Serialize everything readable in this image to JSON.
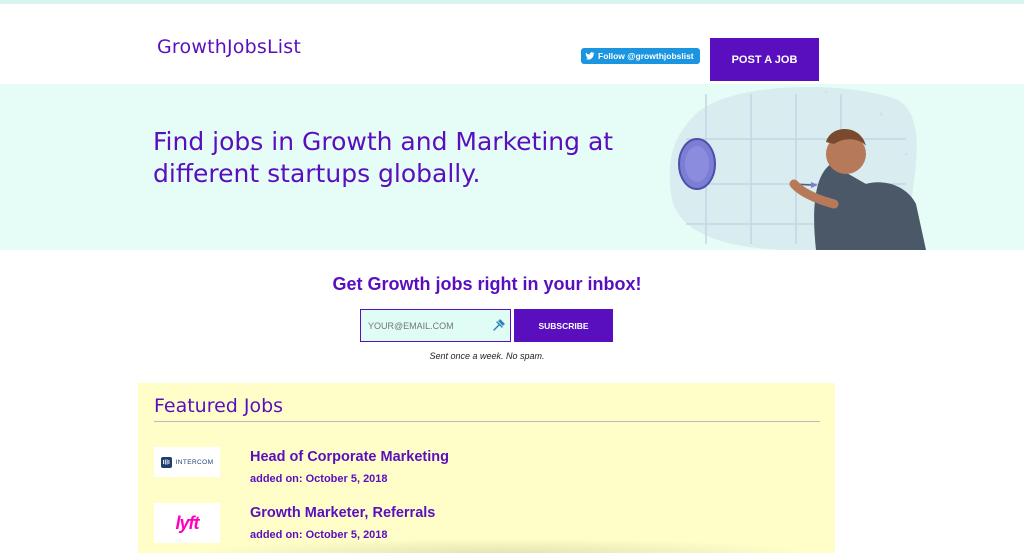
{
  "header": {
    "logo": "GrowthJobsList",
    "twitter_label": "Follow @growthjobslist",
    "post_job_label": "POST A JOB"
  },
  "hero": {
    "title": "Find jobs in Growth and Marketing at different startups globally."
  },
  "subscribe": {
    "title": "Get Growth jobs right in your inbox!",
    "email_placeholder": "YOUR@EMAIL.COM",
    "button_label": "SUBSCRIBE",
    "note": "Sent once a week. No spam."
  },
  "featured": {
    "title": "Featured Jobs",
    "jobs": [
      {
        "title": "Head of Corporate Marketing",
        "date": "added on: October 5, 2018",
        "company_logo": "INTERCOM",
        "logo_icon": "intercom-icon"
      },
      {
        "title": "Growth Marketer, Referrals",
        "date": "added on: October 5, 2018",
        "company_logo": "lyft",
        "logo_icon": "lyft-icon"
      }
    ]
  },
  "colors": {
    "brand_purple": "#5a0fbf",
    "hero_bg": "#e6fcf6",
    "featured_bg": "#fffec8",
    "twitter_blue": "#1b95e0",
    "lyft_pink": "#ff00bf"
  }
}
